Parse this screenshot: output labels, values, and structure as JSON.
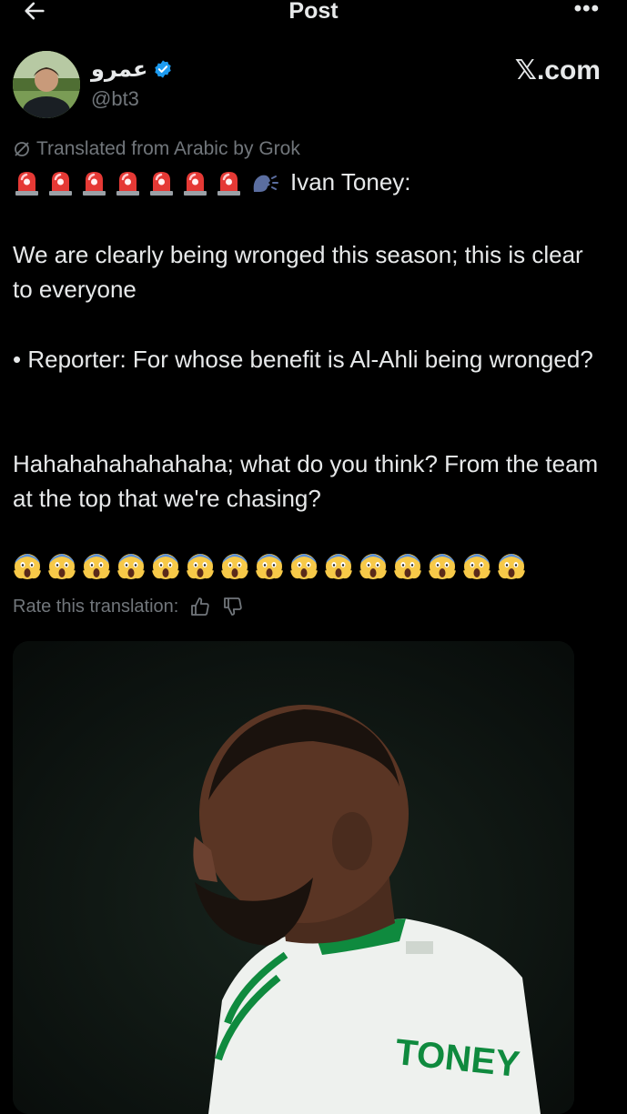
{
  "header": {
    "title": "Post",
    "back_icon": "arrow-left-icon",
    "more_icon": "more-horizontal-icon"
  },
  "author": {
    "name": "عمرو",
    "handle": "@bt3",
    "verified": true,
    "verified_color": "#1d9bf0",
    "watermark": "𝕏.com"
  },
  "translation_note": "Translated from Arabic by Grok",
  "post": {
    "lead_emojis": [
      "rotating-light",
      "rotating-light",
      "rotating-light",
      "rotating-light",
      "rotating-light",
      "rotating-light",
      "rotating-light",
      "speaking-head"
    ],
    "line1": "Ivan Toney:",
    "para1": "We are clearly being wronged this season; this is clear to everyone",
    "para2": "• Reporter: For whose benefit is Al-Ahli being wronged?",
    "para3": "Hahahahahahahaha; what do you think? From the team at the top that we're chasing?",
    "scream_count": 15
  },
  "rate": {
    "label": "Rate this translation:"
  },
  "media": {
    "jersey_text": "TONEY",
    "jersey_color": "#f2f4f2",
    "trim_color": "#0f8a3e"
  }
}
